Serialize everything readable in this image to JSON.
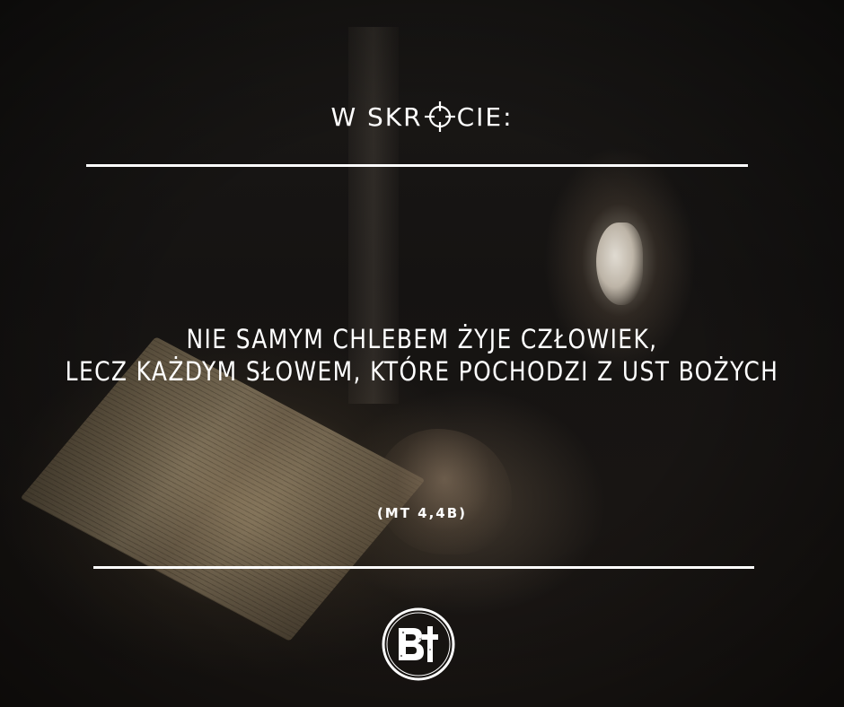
{
  "header": {
    "title_before": "W SKR",
    "title_icon": "crosshair-icon",
    "title_after": "CIE:"
  },
  "quote": {
    "line1": "NIE SAMYM CHLEBEM ŻYJE CZŁOWIEK,",
    "line2": "LECZ KAŻDYM SŁOWEM, KTÓRE POCHODZI Z UST BOŻYCH"
  },
  "reference": "(MT 4,4B)",
  "logo": {
    "icon": "bt-logo-icon",
    "text": "B†"
  },
  "colors": {
    "text": "#ffffff",
    "background": "#141211"
  }
}
